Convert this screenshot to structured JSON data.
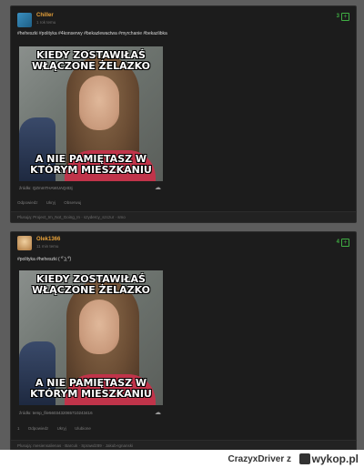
{
  "posts": [
    {
      "author": "Chiller",
      "time": "1 rok temu",
      "votes": "3",
      "tags": "#heheszki #polityka #4konserwy #bekazlewactwa #myrchanie #bekazlibka",
      "meme_top": "KIEDY ZOSTAWIŁAŚ WŁĄCZONE ŻELAZKO",
      "meme_bottom": "A NIE PAMIĘTASZ W KTÓRYM MIESZKANIU",
      "source": "źródło: QZmmTHAWUAQ4t3j",
      "actions": [
        "Odpowiedz",
        "Ukryj",
        "Obserwuj"
      ],
      "helpers": "Plusują: Project_Im_Not_Going_In · szydercy_szczur · smo"
    },
    {
      "author": "Olek1366",
      "time": "11 min temu",
      "votes": "4",
      "tags": "#polityka #heheszki ( ͡° ͜ʖ ͡°)",
      "meme_top": "KIEDY ZOSTAWIŁAŚ WŁĄCZONE ŻELAZKO",
      "meme_bottom": "A NIE PAMIĘTASZ W KTÓRYM MIESZKANIU",
      "source": "źródło: temp_file5603432065710243416",
      "actions": [
        "1",
        "Odpowiedz",
        "Ukryj",
        "Ulubione"
      ],
      "helpers": "Plusują: mesiensalienas · Barcuk · Sprawdz89 · Jakub-Ignanski"
    }
  ],
  "footer": {
    "user": "CrazyxDriver z",
    "brand": "wykop.pl"
  },
  "colors": {
    "author": "#e8a23a",
    "vote": "#3fae43",
    "card_bg": "#1c1c1c"
  }
}
